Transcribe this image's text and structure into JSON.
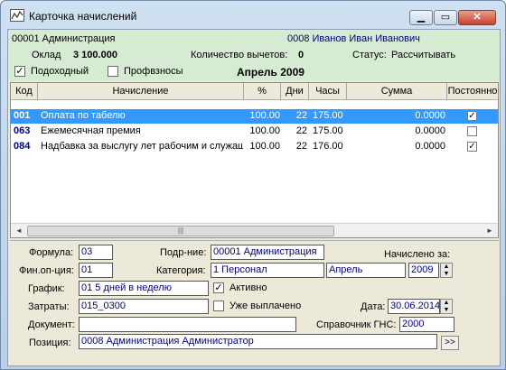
{
  "window": {
    "title": "Карточка начислений",
    "min": "▁",
    "max": "▭",
    "close": "✕"
  },
  "header": {
    "dept": "00001 Администрация",
    "employee": "0008 Иванов Иван Иванович",
    "salary_label": "Оклад",
    "salary_value": "3 100.000",
    "deductions_label": "Количество вычетов:",
    "deductions_value": "0",
    "status_label": "Статус:",
    "status_value": "Рассчитывать",
    "income_tax_label": "Подоходный",
    "income_tax_checked": true,
    "union_label": "Профвзносы",
    "union_checked": false,
    "period": "Апрель 2009"
  },
  "table": {
    "columns": [
      "Код",
      "Начисление",
      "%",
      "Дни",
      "Часы",
      "Сумма",
      "Постоянно"
    ],
    "rows": [
      {
        "code": "001",
        "name": "Оплата по табелю",
        "pct": "100.00",
        "days": "22",
        "hours": "175.00",
        "sum": "0.0000",
        "permanent": true
      },
      {
        "code": "063",
        "name": "Ежемесячная премия",
        "pct": "100.00",
        "days": "22",
        "hours": "175.00",
        "sum": "0.0000",
        "permanent": false
      },
      {
        "code": "084",
        "name": "Надбавка за выслугу лет рабочим и служащ",
        "pct": "100.00",
        "days": "22",
        "hours": "176.00",
        "sum": "0.0000",
        "permanent": true
      }
    ],
    "scroll_left": "◄",
    "scroll_right": "►",
    "scroll_grip": "|||"
  },
  "form": {
    "formula_label": "Формула:",
    "formula_value": "03",
    "subdiv_label": "Подр-ние:",
    "subdiv_value": "00001 Администрация",
    "accrued_label": "Начислено за:",
    "finop_label": "Фин.оп-ция:",
    "finop_value": "01",
    "category_label": "Категория:",
    "category_value": "1  Персонал",
    "month_value": "Апрель",
    "year_value": "2009",
    "schedule_label": "График:",
    "schedule_value": "01 5 дней в неделю",
    "active_label": "Активно",
    "active_checked": true,
    "costs_label": "Затраты:",
    "costs_value": "015_0300",
    "paid_label": "Уже выплачено",
    "paid_checked": false,
    "date_label": "Дата:",
    "date_value": "30.06.2014",
    "document_label": "Документ:",
    "document_value": "",
    "gns_label": "Справочник ГНС:",
    "gns_value": "2000",
    "position_label": "Позиция:",
    "position_value": "0008 Администрация Администратор",
    "position_button": ">>"
  },
  "colors": {
    "selected_row": "#3399ff",
    "header_bg": "#d6ecd2",
    "code_blue": "#000080"
  }
}
